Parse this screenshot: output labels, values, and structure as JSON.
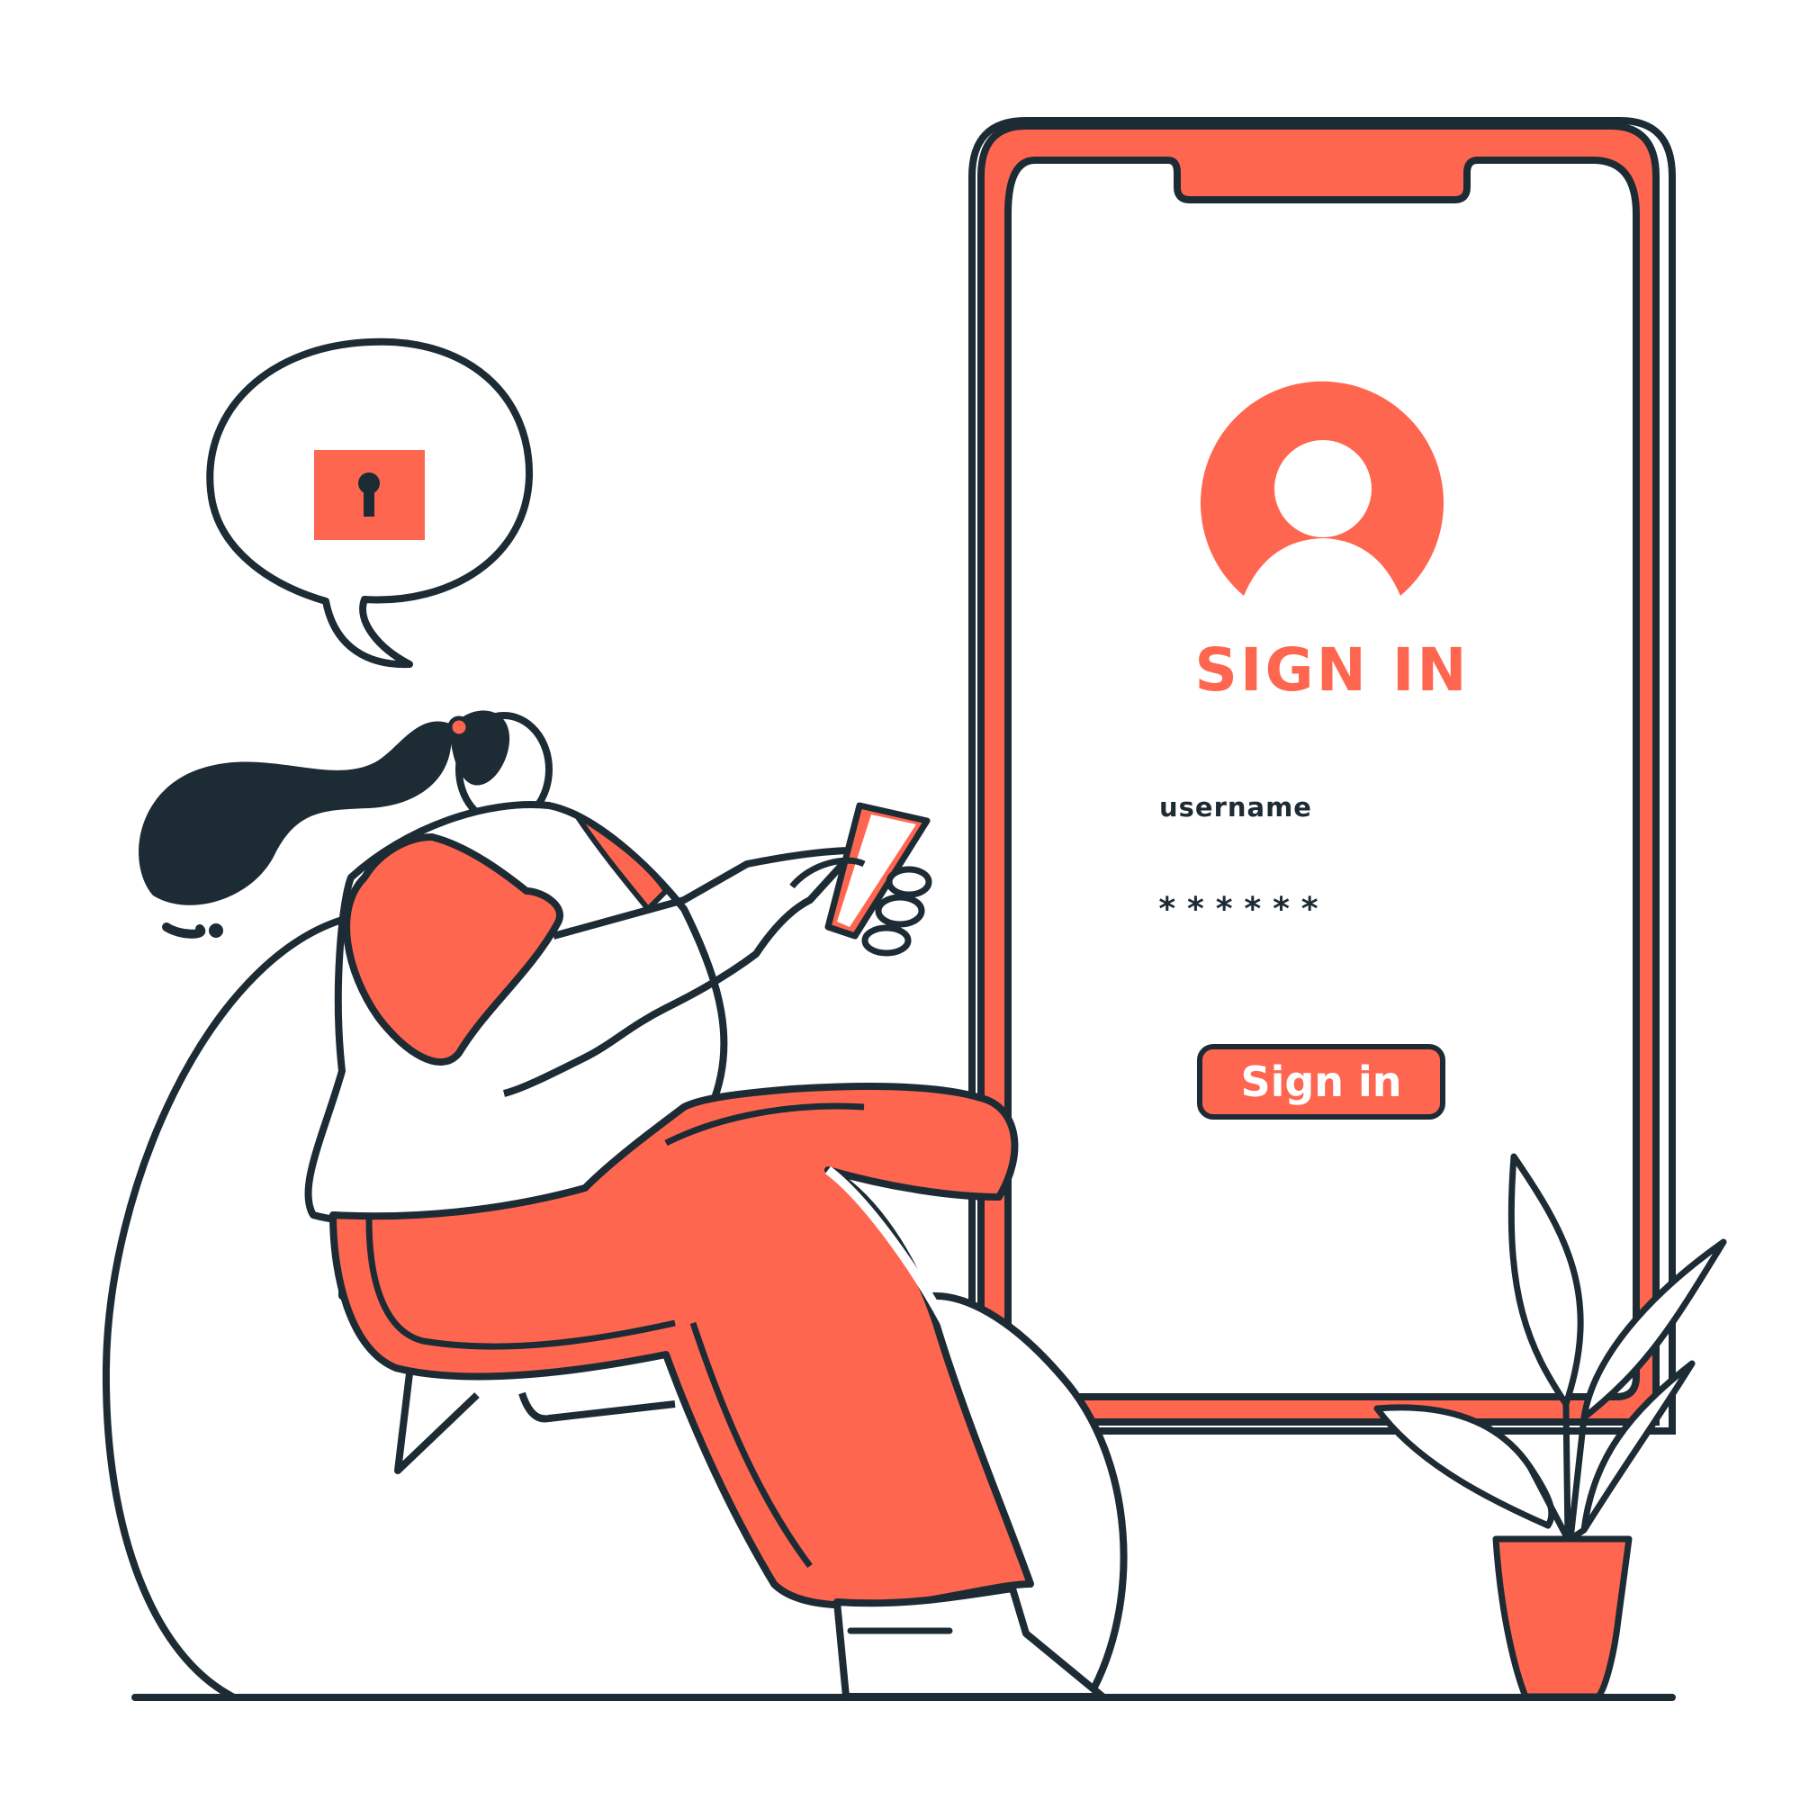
{
  "colors": {
    "accent": "#ff6650",
    "ink": "#1d2b34",
    "background": "#ffffff"
  },
  "phone_screen": {
    "title": "SIGN IN",
    "username_value": "username",
    "password_value": "******",
    "button_label": "Sign in"
  },
  "icons": {
    "avatar": "user-avatar-icon",
    "speech_lock": "padlock-icon",
    "plant": "potted-plant-icon"
  }
}
